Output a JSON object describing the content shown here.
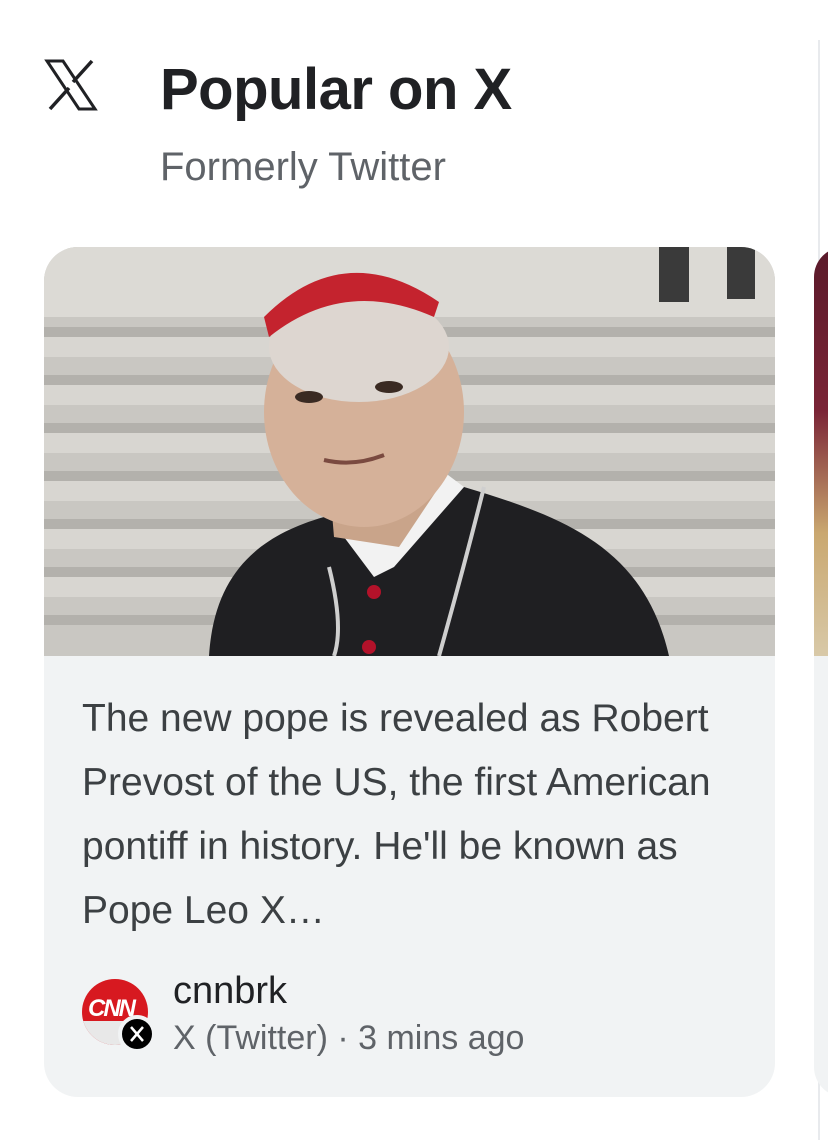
{
  "header": {
    "logo_icon": "x-logo-icon",
    "title": "Popular on X",
    "subtitle": "Formerly Twitter"
  },
  "card": {
    "image": "photo-of-cardinal",
    "text": "The new pope is revealed as Robert Prevost of the US, the first American pontiff in history. He'll be known as Pope Leo X…",
    "source": {
      "avatar_icon": "cnn-avatar-icon",
      "avatar_text": "CNN",
      "badge_icon": "x-badge-icon",
      "name": "cnnbrk",
      "meta": "X (Twitter) · 3 mins ago"
    }
  },
  "colors": {
    "title": "#202124",
    "subtitle": "#5f6368",
    "card_background": "#f1f3f4",
    "cnn_red": "#d71920"
  }
}
